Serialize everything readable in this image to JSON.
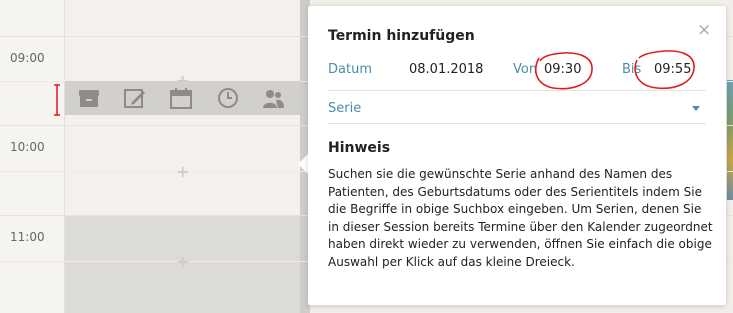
{
  "calendar": {
    "times": [
      "09:00",
      "10:00",
      "11:00"
    ],
    "toolbar_icons": [
      "archive-icon",
      "edit-icon",
      "calendar-icon",
      "clock-icon",
      "users-icon"
    ]
  },
  "popup": {
    "title": "Termin hinzufügen",
    "close_label": "×",
    "date_label": "Datum",
    "date_value": "08.01.2018",
    "from_label": "Von",
    "from_value": "09:30",
    "to_label": "Bis",
    "to_value": "09:55",
    "series_label": "Serie",
    "hint_title": "Hinweis",
    "hint_text": "Suchen sie die gewünschte Serie anhand des Namen des Patienten, des Geburtsdatums oder des Serientitels indem Sie die Begriffe in obige Suchbox eingeben. Um Serien, denen Sie in dieser Session bereits Termine über den Kalender zugeordnet haben direkt wieder zu verwenden, öffnen Sie einfach die obige Auswahl per Klick auf das kleine Dreieck."
  },
  "colors": {
    "accent": "#4a8ea8",
    "annotation": "#e01b1b"
  }
}
